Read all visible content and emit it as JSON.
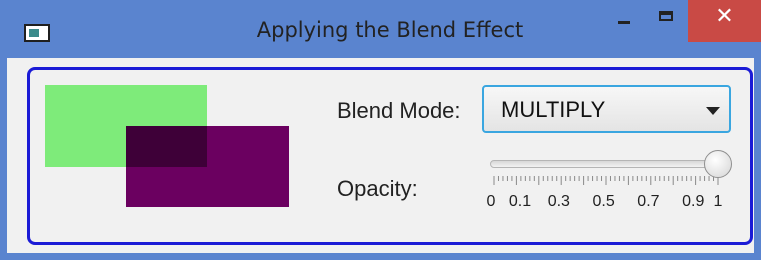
{
  "window": {
    "title": "Applying the Blend Effect",
    "close_glyph": "✕",
    "icons": {
      "app": "app-window-icon",
      "minimize": "minimize-icon",
      "maximize": "maximize-icon",
      "close": "close-icon"
    }
  },
  "colors": {
    "titlebar": "#5a84cf",
    "close_button": "#c94a45",
    "panel_border": "#1b1bd6",
    "top_rect": "#7eeb7a",
    "bottom_rect": "#6b0060",
    "overlap": "#3e0038",
    "combo_focus": "#3aa6e0"
  },
  "controls": {
    "blend_label": "Blend Mode:",
    "blend_value": "MULTIPLY",
    "opacity_label": "Opacity:",
    "opacity_value": 1.0,
    "opacity_min": 0,
    "opacity_max": 1,
    "tick_labels": [
      "0",
      "0.1",
      "0.3",
      "0.5",
      "0.7",
      "0.9",
      "1"
    ]
  }
}
